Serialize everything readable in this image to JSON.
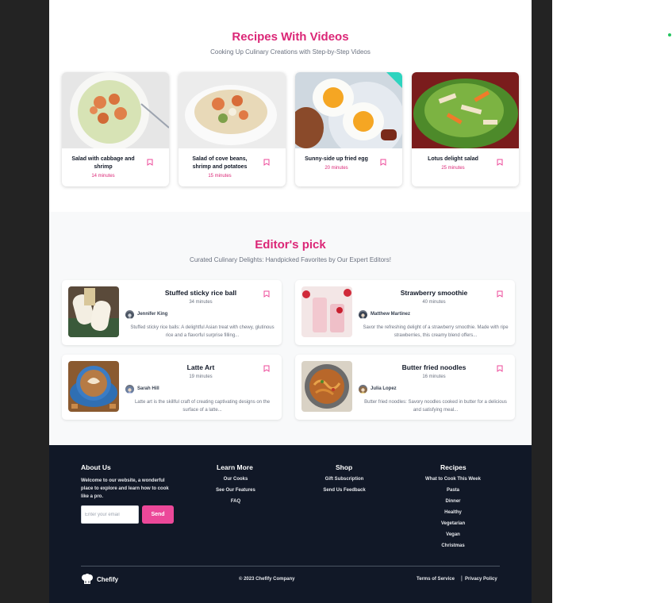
{
  "colors": {
    "accent": "#db2777",
    "button": "#ec4899",
    "footer_bg": "#111827",
    "section_bg": "#f8f9fa"
  },
  "videos": {
    "title": "Recipes With Videos",
    "subtitle": "Cooking Up Culinary Creations with Step-by-Step Videos",
    "items": [
      {
        "title": "Salad with cabbage and shrimp",
        "time": "14 minutes"
      },
      {
        "title": "Salad of cove beans, shrimp and potatoes",
        "time": "15 minutes"
      },
      {
        "title": "Sunny-side up fried egg",
        "time": "20 minutes"
      },
      {
        "title": "Lotus delight salad",
        "time": "25 minutes"
      }
    ]
  },
  "editors": {
    "title": "Editor's pick",
    "subtitle": "Curated Culinary Delights: Handpicked Favorites by Our Expert Editors!",
    "items": [
      {
        "title": "Stuffed sticky rice ball",
        "time": "34 minutes",
        "author": "Jennifer King",
        "desc": "Stuffed sticky rice balls: A delightful Asian treat with chewy, glutinous rice and a flavorful surprise filling..."
      },
      {
        "title": "Strawberry smoothie",
        "time": "40 minutes",
        "author": "Matthew Martinez",
        "desc": "Savor the refreshing delight of a strawberry smoothie. Made with ripe strawberries, this creamy blend offers..."
      },
      {
        "title": "Latte Art",
        "time": "19 minutes",
        "author": "Sarah Hill",
        "desc": "Latte art is the skillful craft of creating captivating designs on the surface of a latte..."
      },
      {
        "title": "Butter fried noodles",
        "time": "16 minutes",
        "author": "Julia Lopez",
        "desc": "Butter fried noodles: Savory noodles cooked in butter for a delicious and satisfying meal..."
      }
    ]
  },
  "footer": {
    "about": {
      "heading": "About Us",
      "text": "Welcome to our website, a wonderful place to explore and learn how to cook like a pro.",
      "email_placeholder": "Enter your email",
      "send": "Send"
    },
    "learn": {
      "heading": "Learn More",
      "links": [
        "Our Cooks",
        "See Our Features",
        "FAQ"
      ]
    },
    "shop": {
      "heading": "Shop",
      "links": [
        "Gift Subscription",
        "Send Us Feedback"
      ]
    },
    "recipes": {
      "heading": "Recipes",
      "links": [
        "What to Cook This Week",
        "Pasta",
        "Dinner",
        "Healthy",
        "Vegetarian",
        "Vegan",
        "Christmas"
      ]
    },
    "brand": "Chefify",
    "copyright": "© 2023 Chefify Company",
    "terms": "Terms of Service",
    "privacy": "Privacy Policy",
    "separator": "|"
  }
}
